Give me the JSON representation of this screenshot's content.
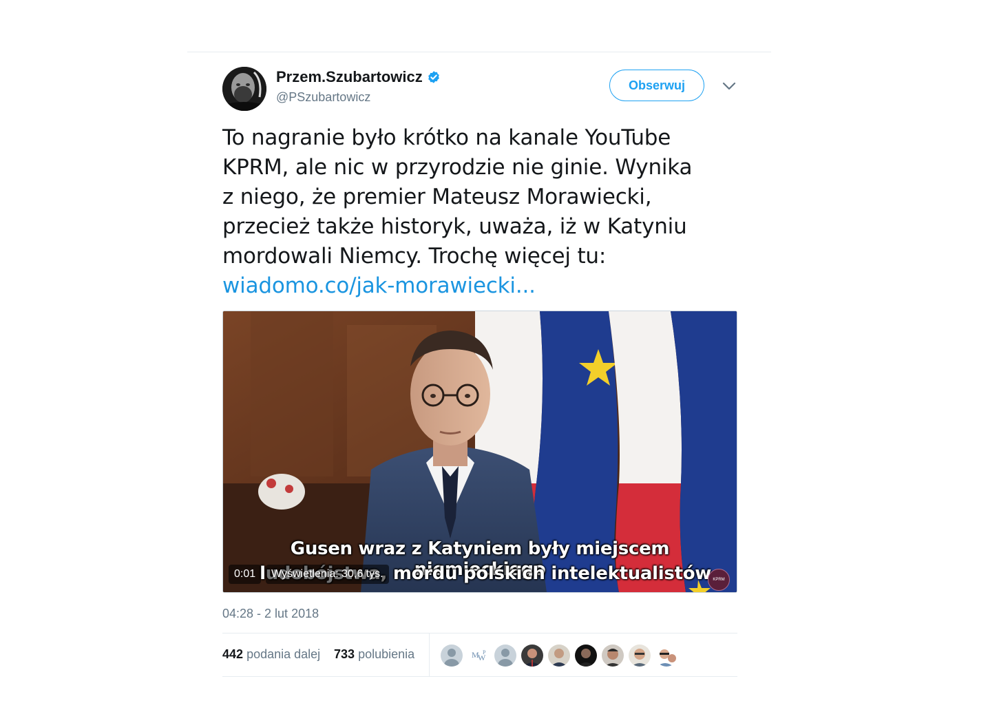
{
  "tweet": {
    "display_name": "Przem.Szubartowicz",
    "handle": "@PSzubartowicz",
    "follow_label": "Obserwuj",
    "text_lines": [
      "To nagranie było krótko na kanale YouTube",
      "KPRM, ale nic w przyrodzie nie ginie. Wynika",
      "z niego, że premier Mateusz Morawiecki,",
      "przecież także historyk, uważa, iż w Katyniu",
      "mordowali Niemcy. Trochę więcej tu:"
    ],
    "link_text": "wiadomo.co/jak-morawiecki...",
    "timestamp": "04:28 - 2 lut 2018"
  },
  "video": {
    "subtitle_line1": "Gusen wraz z Katyniem były miejscem niemieckiego",
    "subtitle_line2": "ludobójstwa, mordu polskich intelektualistów.",
    "elapsed": "0:01",
    "views": "Wyświetlenia: 30,6 tys."
  },
  "stats": {
    "retweets_count": "442",
    "retweets_label": "podania dalej",
    "likes_count": "733",
    "likes_label": "polubienia"
  },
  "icons": {
    "verified": "verified-badge-icon",
    "menu": "chevron-down-icon"
  },
  "colors": {
    "accent": "#1da1f2",
    "link": "#1b95e0",
    "muted": "#657786"
  }
}
